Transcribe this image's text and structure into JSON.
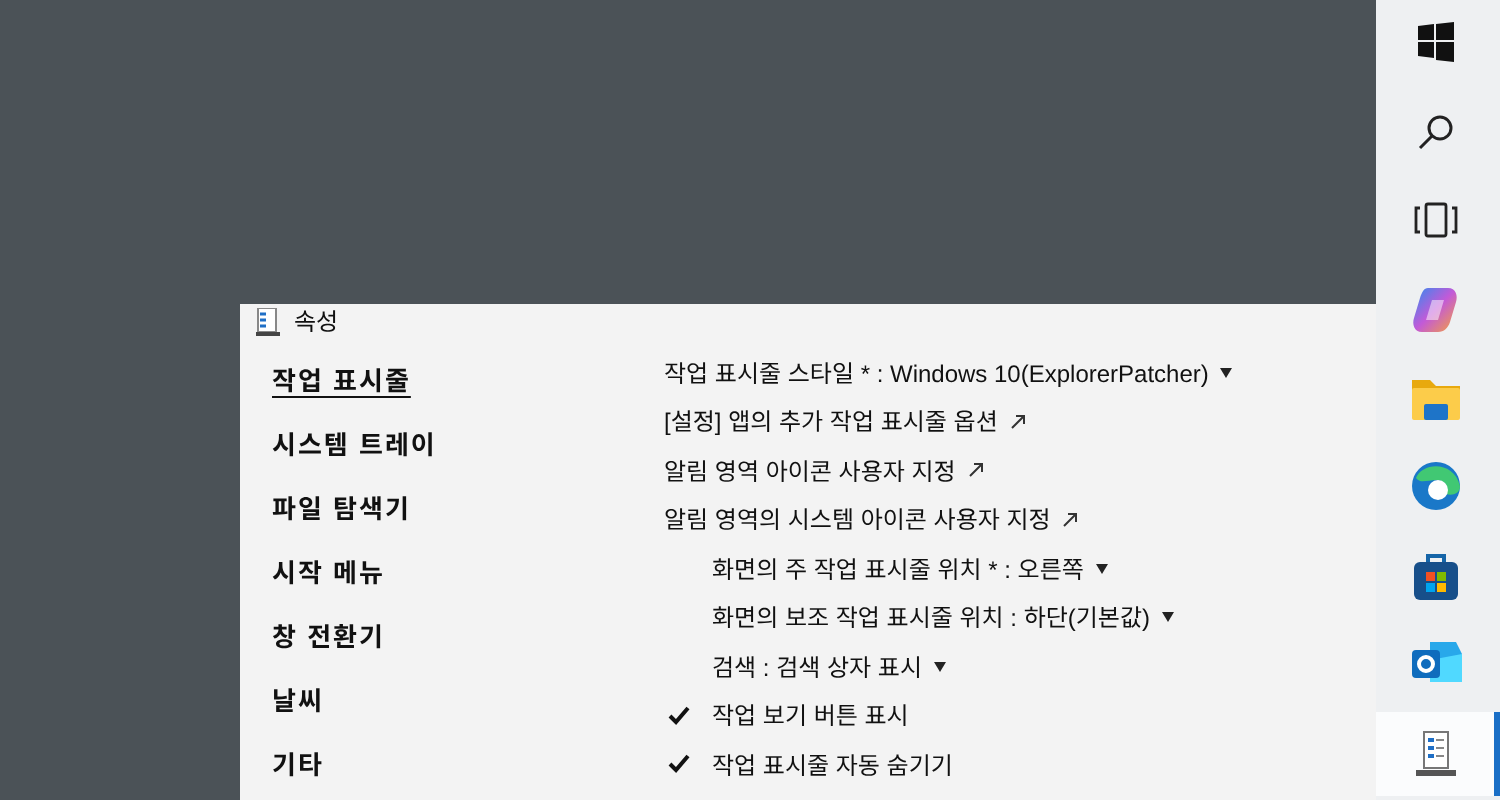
{
  "window": {
    "title": "속성"
  },
  "sidebar": {
    "items": [
      {
        "label": "작업 표시줄",
        "selected": true
      },
      {
        "label": "시스템 트레이",
        "selected": false
      },
      {
        "label": "파일 탐색기",
        "selected": false
      },
      {
        "label": "시작 메뉴",
        "selected": false
      },
      {
        "label": "창 전환기",
        "selected": false
      },
      {
        "label": "날씨",
        "selected": false
      },
      {
        "label": "기타",
        "selected": false
      }
    ]
  },
  "settings": [
    {
      "kind": "dropdown",
      "label": "작업 표시줄 스타일 * : Windows 10(ExplorerPatcher)"
    },
    {
      "kind": "link",
      "label": "[설정] 앱의 추가 작업 표시줄 옵션"
    },
    {
      "kind": "link",
      "label": "알림 영역 아이콘 사용자 지정"
    },
    {
      "kind": "link",
      "label": "알림 영역의 시스템 아이콘 사용자 지정"
    },
    {
      "kind": "subdropdown",
      "label": "화면의 주 작업 표시줄 위치 * : 오른쪽"
    },
    {
      "kind": "subdropdown",
      "label": "화면의 보조 작업 표시줄 위치 : 하단(기본값)"
    },
    {
      "kind": "subdropdown",
      "label": "검색 : 검색 상자 표시"
    },
    {
      "kind": "check",
      "label": "작업 보기 버튼 표시",
      "checked": true
    },
    {
      "kind": "check",
      "label": "작업 표시줄 자동 숨기기",
      "checked": true
    }
  ],
  "taskbar": {
    "items": [
      {
        "kind": "start",
        "selected": false
      },
      {
        "kind": "search",
        "selected": false
      },
      {
        "kind": "taskview",
        "selected": false
      },
      {
        "kind": "swirl",
        "selected": false
      },
      {
        "kind": "folder",
        "selected": false
      },
      {
        "kind": "browser",
        "selected": false
      },
      {
        "kind": "store",
        "selected": false
      },
      {
        "kind": "mail",
        "selected": false
      },
      {
        "kind": "properties",
        "selected": true
      }
    ]
  }
}
